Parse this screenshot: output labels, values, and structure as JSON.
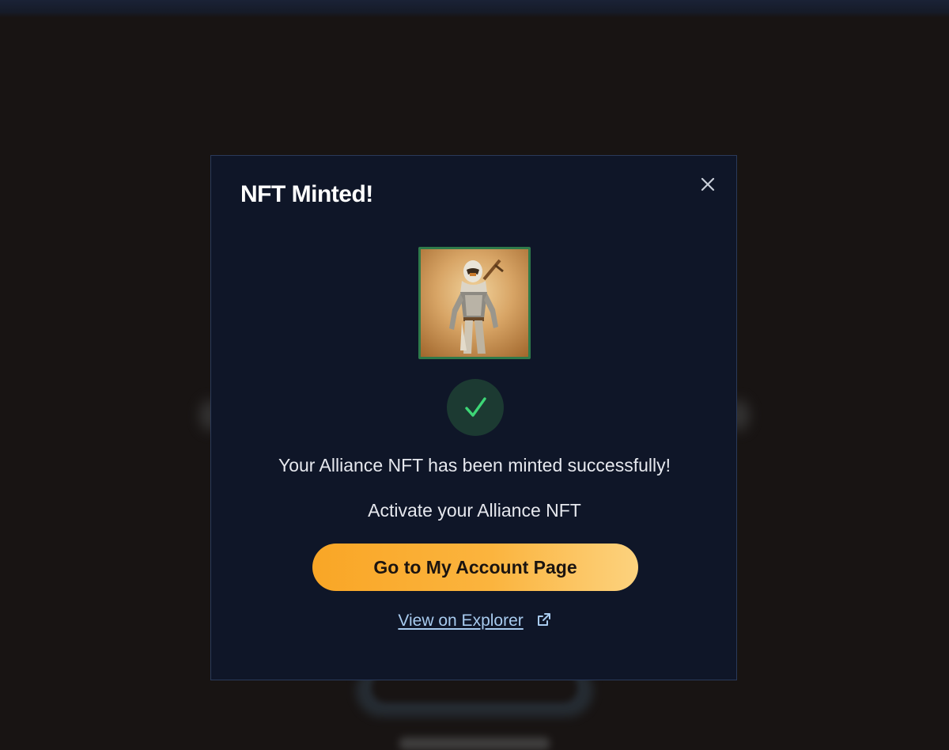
{
  "modal": {
    "title": "NFT Minted!",
    "close_icon": "close-icon",
    "nft_image": "alliance-nft-warrior",
    "status_icon": "checkmark-icon",
    "success_message": "Your Alliance NFT has been minted successfully!",
    "activate_message": "Activate your Alliance NFT",
    "primary_button_label": "Go to My Account Page",
    "explorer_link_label": "View on Explorer",
    "explorer_link_icon": "external-link-icon"
  },
  "colors": {
    "background": "#181413",
    "modal_bg": "#0f1628",
    "modal_border": "#2a3a5a",
    "accent_orange": "#f9a626",
    "success_green": "#3dd676",
    "link": "#a8cbef"
  }
}
